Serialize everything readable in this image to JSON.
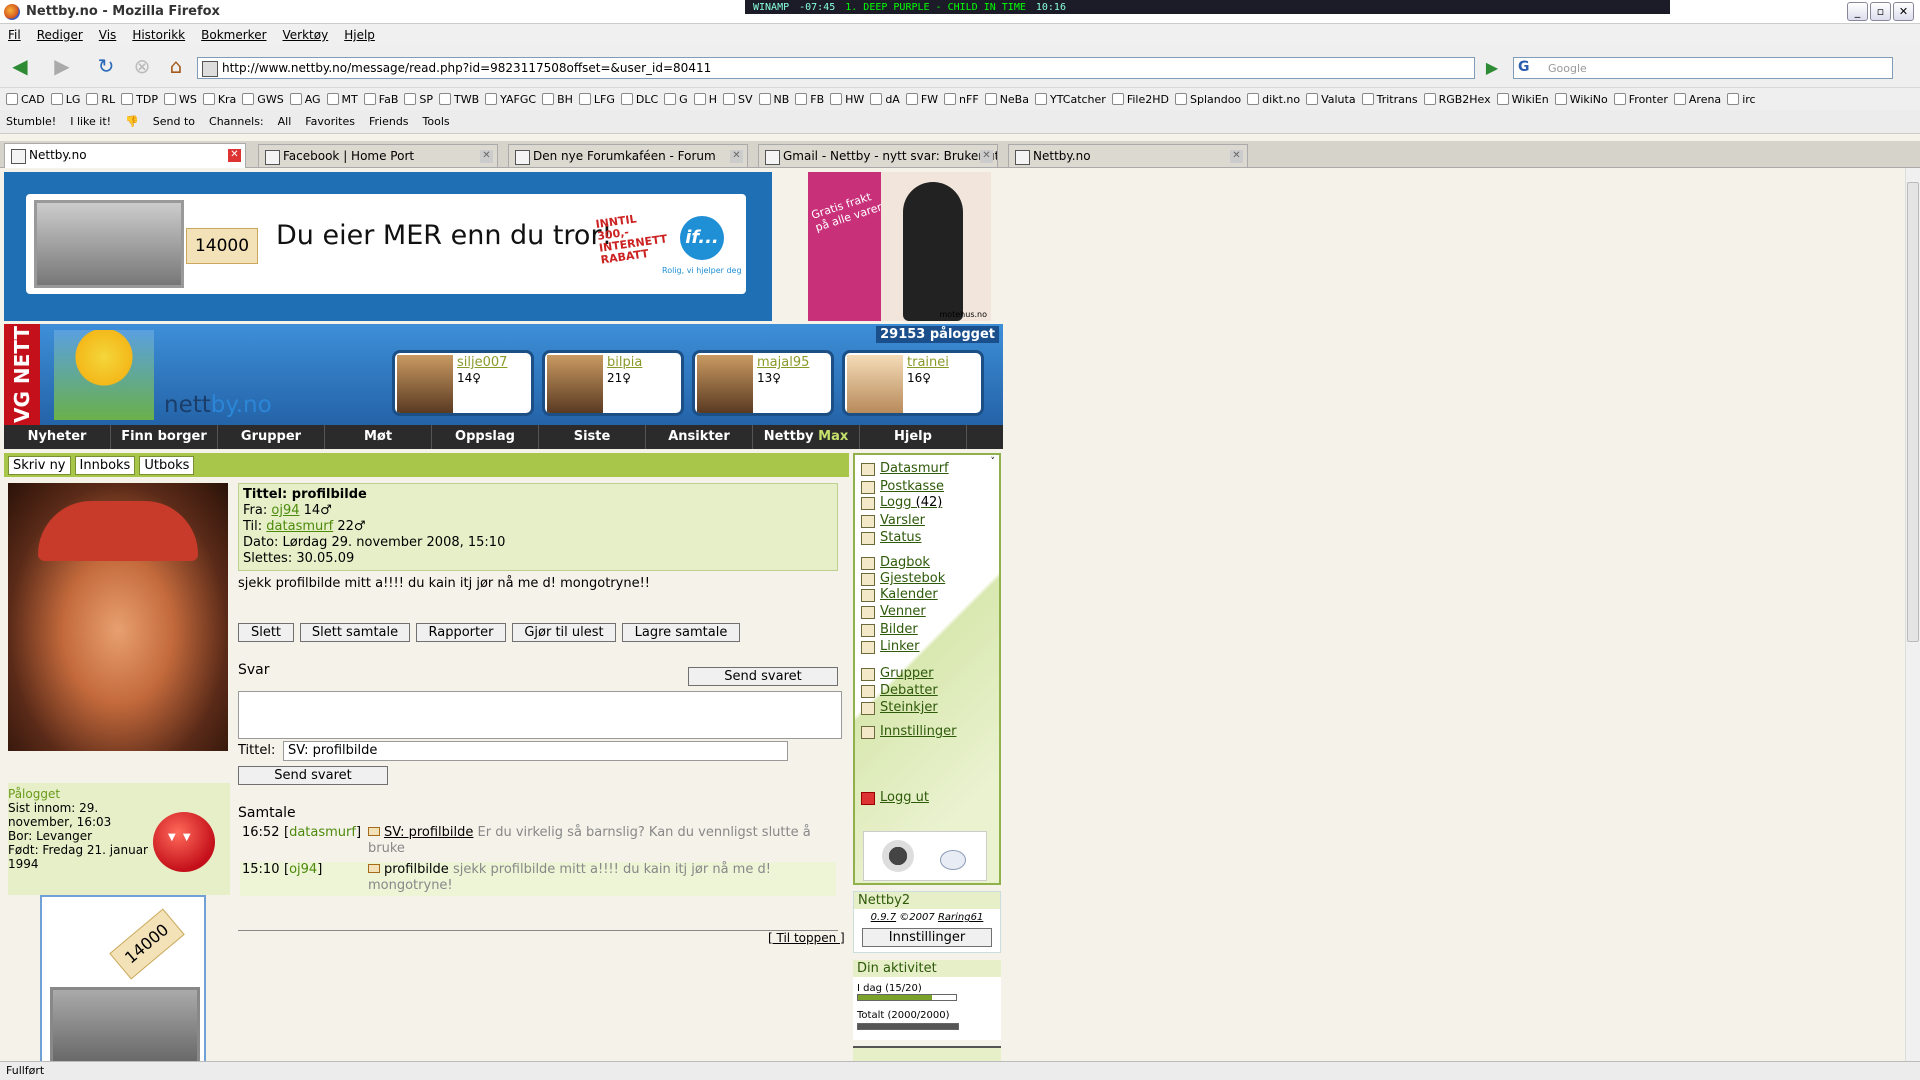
{
  "window": {
    "title": "Nettby.no - Mozilla Firefox"
  },
  "winamp": {
    "label": "WINAMP",
    "time_left": "-07:45",
    "song": "1. DEEP PURPLE - CHILD IN TIME",
    "clock": "10:16"
  },
  "menu": [
    "Fil",
    "Rediger",
    "Vis",
    "Historikk",
    "Bokmerker",
    "Verktøy",
    "Hjelp"
  ],
  "nav": {
    "url": "http://www.nettby.no/message/read.php?id=9823117508offset=&user_id=80411",
    "search_placeholder": "Google"
  },
  "bookmarks": [
    "CAD",
    "LG",
    "RL",
    "TDP",
    "WS",
    "Kra",
    "GWS",
    "AG",
    "MT",
    "FaB",
    "SP",
    "TWB",
    "YAFGC",
    "BH",
    "LFG",
    "DLC",
    "G",
    "H",
    "SV",
    "NB",
    "FB",
    "HW",
    "dA",
    "FW",
    "nFF",
    "NeBa",
    "YTCatcher",
    "File2HD",
    "Splandoo",
    "dikt.no",
    "Valuta",
    "Tritrans",
    "RGB2Hex",
    "WikiEn",
    "WikiNo",
    "Fronter",
    "Arena",
    "irc"
  ],
  "stumble": {
    "stumble": "Stumble!",
    "like": "I like it!",
    "send": "Send to",
    "channels": "Channels:",
    "all": "All",
    "favorites": "Favorites",
    "friends": "Friends",
    "tools": "Tools"
  },
  "tabs": [
    "Nettby.no",
    "Facebook | Home Port",
    "Den nye Forumkaféen - Forum",
    "Gmail - Nettby - nytt svar: Bruker ute...",
    "Nettby.no"
  ],
  "status": "Fullført",
  "ad": {
    "price": "14000",
    "headline": "Du eier MER enn du tror!",
    "rabatt": "INNTIL 300,- INTERNETT RABATT",
    "brand": "if...",
    "slogan": "Rolig, vi hjelper deg"
  },
  "ad2": {
    "text": "Gratis frakt på alle varer",
    "brand": "motehus.no"
  },
  "header": {
    "vg": "VG NETT",
    "logo_a": "nett",
    "logo_b": "by.no",
    "online": "29153 pålogget"
  },
  "users": [
    {
      "name": "silje007",
      "age": "14♀"
    },
    {
      "name": "bilpia",
      "age": "21♀"
    },
    {
      "name": "majal95",
      "age": "13♀"
    },
    {
      "name": "trainei",
      "age": "16♀"
    }
  ],
  "mainnav": [
    "Nyheter",
    "Finn borger",
    "Grupper",
    "Møt",
    "Oppslag",
    "Siste",
    "Ansikter",
    "Nettby",
    "Hjelp"
  ],
  "mainnav_max": "Max",
  "subnav": [
    "Skriv ny",
    "Innboks",
    "Utboks"
  ],
  "profile": {
    "status": "Pålogget",
    "last_seen": "Sist innom: 29. november, 16:03",
    "lives": "Bor: Levanger",
    "born": "Født: Fredag 21. januar 1994"
  },
  "ad3": {
    "price": "14000"
  },
  "message": {
    "title_label": "Tittel:",
    "title": "profilbilde",
    "from_label": "Fra:",
    "from_user": "oj94",
    "from_age": "14♂",
    "to_label": "Til:",
    "to_user": "datasmurf",
    "to_age": "22♂",
    "date": "Dato: Lørdag 29. november 2008, 15:10",
    "deleted": "Slettes: 30.05.09",
    "body": "sjekk profilbilde mitt a!!!! du kain itj jør nå me d! mongotryne!!"
  },
  "actions": {
    "delete": "Slett",
    "delete_conv": "Slett samtale",
    "report": "Rapporter",
    "unread": "Gjør til ulest",
    "save_conv": "Lagre samtale"
  },
  "reply": {
    "label": "Svar",
    "send_top": "Send svaret",
    "title_label": "Tittel:",
    "title_value": "SV: profilbilde",
    "send": "Send svaret"
  },
  "conversation": {
    "label": "Samtale",
    "items": [
      {
        "time": "16:52",
        "user": "datasmurf",
        "subject": "SV: profilbilde",
        "excerpt": "Er du virkelig så barnslig? Kan du vennligst slutte å bruke"
      },
      {
        "time": "15:10",
        "user": "oj94",
        "subject": "profilbilde",
        "excerpt": "sjekk profilbilde mitt a!!!! du kain itj jør nå me d! mongotryne!"
      }
    ]
  },
  "til_topp": "[ Til toppen ]",
  "sidebar": {
    "items": [
      {
        "label": "Datasmurf",
        "count": ""
      },
      {
        "label": "Postkasse",
        "count": ""
      },
      {
        "label": "Logg",
        "count": "(42)"
      },
      {
        "label": "Varsler",
        "count": ""
      },
      {
        "label": "Status",
        "count": ""
      },
      {
        "label": "Dagbok",
        "count": ""
      },
      {
        "label": "Gjestebok",
        "count": ""
      },
      {
        "label": "Kalender",
        "count": ""
      },
      {
        "label": "Venner",
        "count": ""
      },
      {
        "label": "Bilder",
        "count": ""
      },
      {
        "label": "Linker",
        "count": ""
      },
      {
        "label": "Grupper",
        "count": ""
      },
      {
        "label": "Debatter",
        "count": ""
      },
      {
        "label": "Steinkjer",
        "count": ""
      },
      {
        "label": "Innstillinger",
        "count": ""
      }
    ],
    "logout": "Logg ut"
  },
  "nettby2": {
    "title": "Nettby2",
    "version": "0.9.7",
    "copy": "©2007",
    "author": "Raring61",
    "settings": "Innstillinger"
  },
  "activity": {
    "title": "Din aktivitet",
    "today": "I dag (15/20)",
    "today_pct": 75,
    "total": "Totalt (2000/2000)",
    "total_pct": 100
  }
}
